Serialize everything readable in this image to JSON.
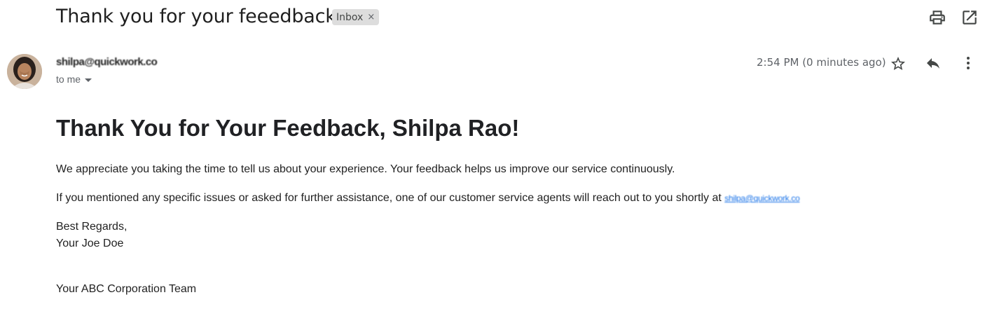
{
  "email": {
    "subject": "Thank you for your feeedback..",
    "label": "Inbox",
    "label_remove": "×",
    "sender": "shilpa@quickwork.co",
    "recipient": "to me",
    "time": "2:54 PM (0 minutes ago)"
  },
  "icons": {
    "print": "print-icon",
    "open_new": "open-in-new-window-icon",
    "star": "star-icon",
    "reply": "reply-icon",
    "more": "more-vertical-icon"
  },
  "body": {
    "heading": "Thank You for Your Feedback, Shilpa Rao!",
    "para1": "We appreciate you taking the time to tell us about your experience. Your feedback helps us improve our service continuously.",
    "para2_text": "If you mentioned any specific issues or asked for further assistance, one of our customer service agents will reach out to you shortly at",
    "para2_email": "shilpa@quickwork.co",
    "closing": "Best Regards,",
    "signature": "Your Joe Doe",
    "team": "Your ABC Corporation Team"
  },
  "colors": {
    "link": "#1a73e8",
    "label_chip": "#dddddd",
    "secondary_text": "#5f6368"
  }
}
